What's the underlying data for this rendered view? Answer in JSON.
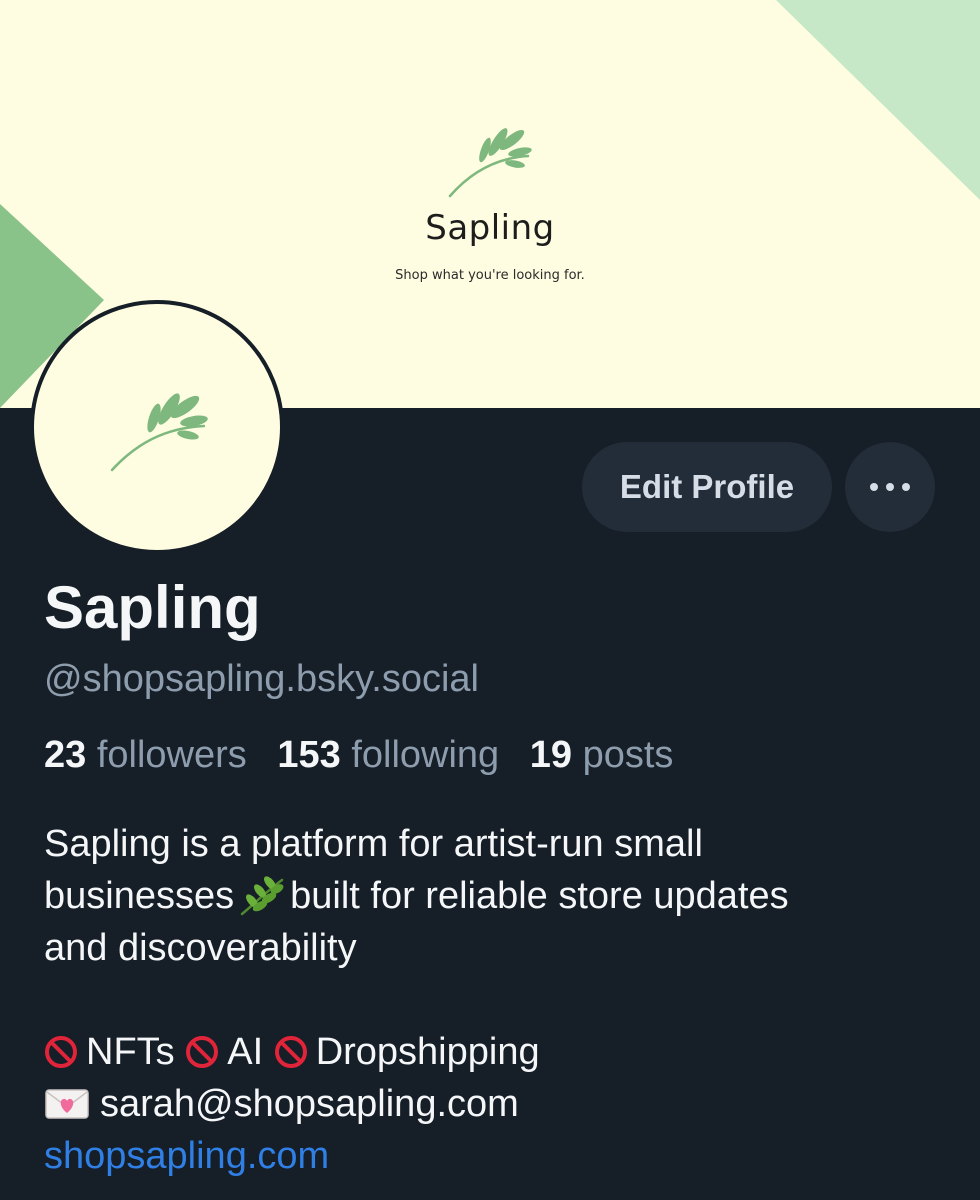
{
  "banner": {
    "title": "Sapling",
    "tagline": "Shop what you're looking for.",
    "logo_icon": "sapling-sprig-logo",
    "colors": {
      "background": "#fefde1",
      "accent_dark_green": "#8ac38a",
      "accent_light_green": "#c6e8c6",
      "leaf_green": "#7eb87e"
    }
  },
  "profile": {
    "avatar_icon": "sapling-sprig-logo",
    "display_name": "Sapling",
    "handle": "@shopsapling.bsky.social",
    "stats": {
      "followers_count": "23",
      "followers_label": "followers",
      "following_count": "153",
      "following_label": "following",
      "posts_count": "19",
      "posts_label": "posts"
    },
    "bio": {
      "line1": "Sapling is a platform for artist-run small",
      "line2_before": "businesses",
      "line2_icon": "herb-emoji",
      "line2_after": "built for reliable store updates",
      "line3": "and discoverability",
      "ban_icon": "prohibited-emoji",
      "ban_items": [
        "NFTs",
        "AI",
        "Dropshipping"
      ],
      "mail_icon": "love-letter-emoji",
      "email": "sarah@shopsapling.com",
      "website": "shopsapling.com"
    }
  },
  "actions": {
    "edit_profile_label": "Edit Profile",
    "more_icon": "ellipsis-icon"
  },
  "theme": {
    "page_background": "#161e27",
    "button_background": "#222d39",
    "text_primary": "#f4f6f8",
    "text_secondary": "#8e9dad",
    "link_color": "#2f7fe4"
  }
}
